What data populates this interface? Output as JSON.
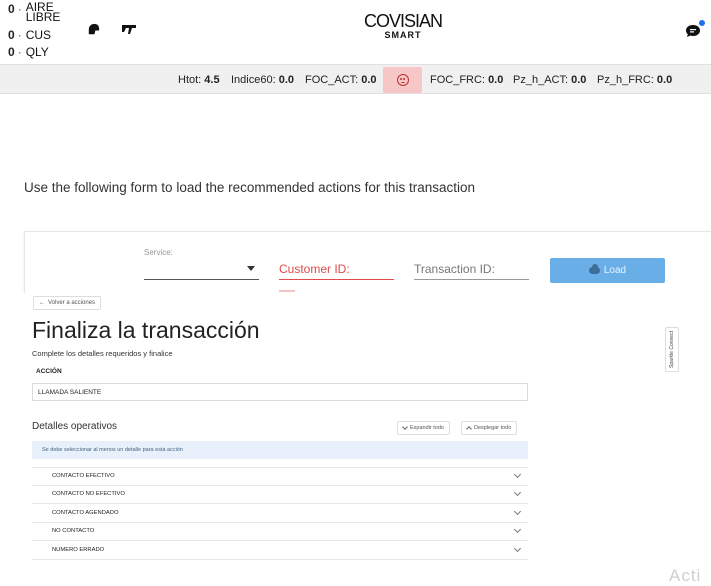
{
  "header": {
    "counters": [
      {
        "value": "0",
        "label": "AIRE LIBRE"
      },
      {
        "value": "0",
        "label": "CUS"
      },
      {
        "value": "0",
        "label": "QLY"
      }
    ],
    "logo_top": "COVISIAN",
    "logo_bottom": "SMART"
  },
  "metrics": {
    "htot_label": "Htot:",
    "htot_value": "4.5",
    "indice_label": "Indice60:",
    "indice_value": "0.0",
    "foc_act_label": "FOC_ACT:",
    "foc_act_value": "0.0",
    "foc_frc_label": "FOC_FRC:",
    "foc_frc_value": "0.0",
    "pz_act_label": "Pz_h_ACT:",
    "pz_act_value": "0.0",
    "pz_frc_label": "Pz_h_FRC:",
    "pz_frc_value": "0.0"
  },
  "instruction": "Use the following form to load the recommended actions for this transaction",
  "form": {
    "service_label": "Service:",
    "customer_placeholder": "Customer ID:",
    "transaction_placeholder": "Transaction ID:",
    "load_label": "Load",
    "accent": "#6aaee8",
    "error_color": "#e04a4a"
  },
  "transaction": {
    "back_label": "Volver a acciones",
    "title": "Finaliza la transacción",
    "subtitle": "Complete los detalles requeridos y finalice",
    "action_label": "ACCIÓN",
    "action_value": "LLAMADA SALIENTE",
    "details_title": "Detalles operativos",
    "expand_label": "Expandir todo",
    "collapse_label": "Desplegar todo",
    "notice": "Se debe seleccionar al menos un detalle para esta acción",
    "options": [
      "CONTACTO EFECTIVO",
      "CONTACTO NO EFECTIVO",
      "CONTACTO AGENDADO",
      "NO CONTACTO",
      "NUMERO ERRADO"
    ],
    "side_tab": "Sparkle Connect"
  },
  "watermark": "Acti"
}
